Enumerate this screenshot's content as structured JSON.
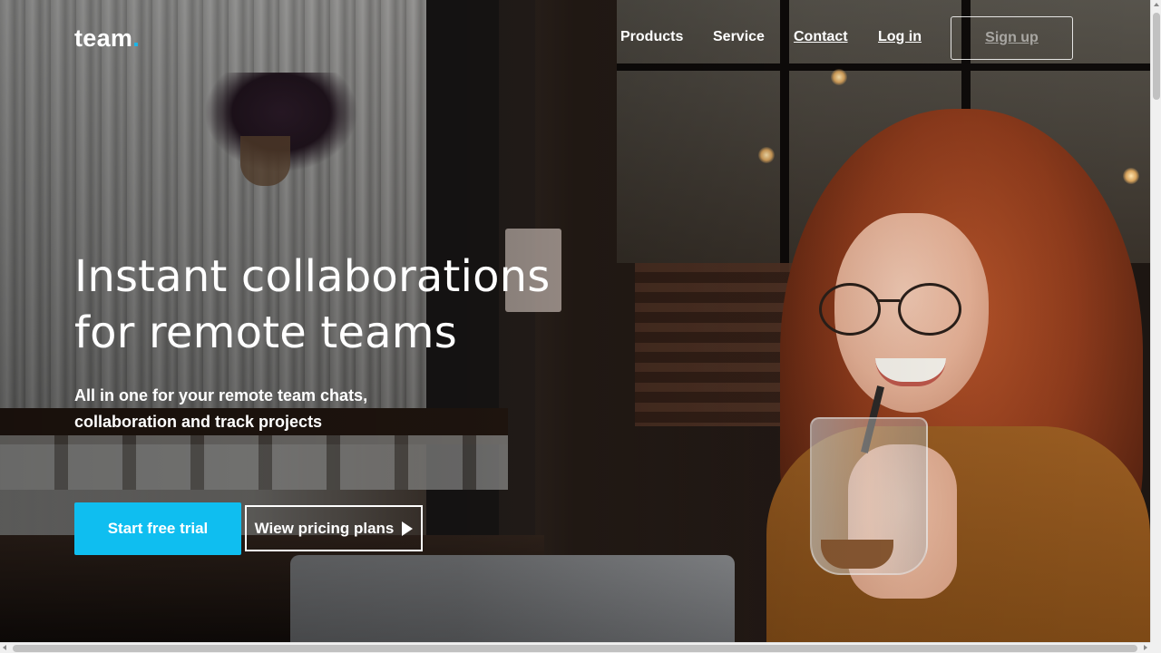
{
  "header": {
    "logo_text": "team",
    "logo_dot": ".",
    "nav": {
      "products": "Products",
      "service": "Service",
      "contact": "Contact",
      "login": "Log in",
      "signup": "Sign up"
    }
  },
  "hero": {
    "title_line1": "Instant collaborations",
    "title_line2": "for remote teams",
    "subtitle_line1": "All in one for your remote team chats,",
    "subtitle_line2": "collaboration and track projects",
    "primary_cta": "Start free trial",
    "secondary_cta": "Wiew pricing plans"
  },
  "colors": {
    "accent": "#0fbef0",
    "logo_dot": "#1ab7ea",
    "text": "#ffffff"
  },
  "icons": {
    "secondary_cta_icon": "play-icon"
  }
}
